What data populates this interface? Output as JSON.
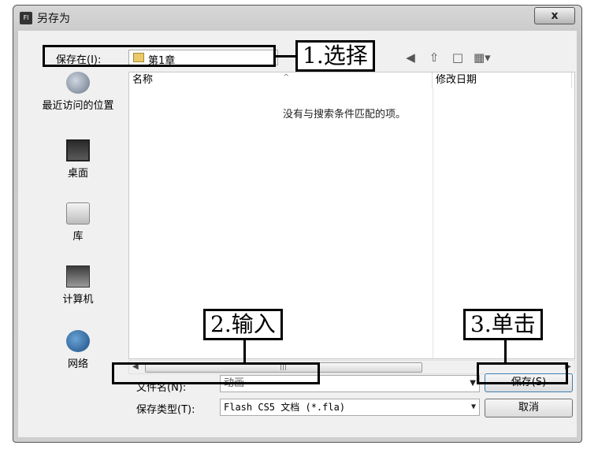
{
  "window": {
    "title": "另存为",
    "app_icon_text": "Fl",
    "close_label": "x"
  },
  "toolbar": {
    "save_in_label": "保存在(I):",
    "current_folder": "第1章",
    "nav_icons": [
      "back-icon",
      "up-folder-icon",
      "new-folder-icon",
      "view-menu-icon"
    ]
  },
  "sidebar": {
    "items": [
      {
        "label": "最近访问的位置",
        "icon": "recent-places-icon"
      },
      {
        "label": "桌面",
        "icon": "desktop-icon"
      },
      {
        "label": "库",
        "icon": "libraries-icon"
      },
      {
        "label": "计算机",
        "icon": "computer-icon"
      },
      {
        "label": "网络",
        "icon": "network-icon"
      }
    ]
  },
  "file_list": {
    "columns": [
      "名称",
      "修改日期"
    ],
    "empty_message": "没有与搜索条件匹配的项。"
  },
  "form": {
    "filename_label": "文件名(N):",
    "filename_value": "动画",
    "filetype_label": "保存类型(T):",
    "filetype_value": "Flash CS5 文档 (*.fla)"
  },
  "buttons": {
    "save": "保存(S)",
    "cancel": "取消"
  },
  "annotations": {
    "step1": "1.选择",
    "step2": "2.输入",
    "step3": "3.单击"
  }
}
